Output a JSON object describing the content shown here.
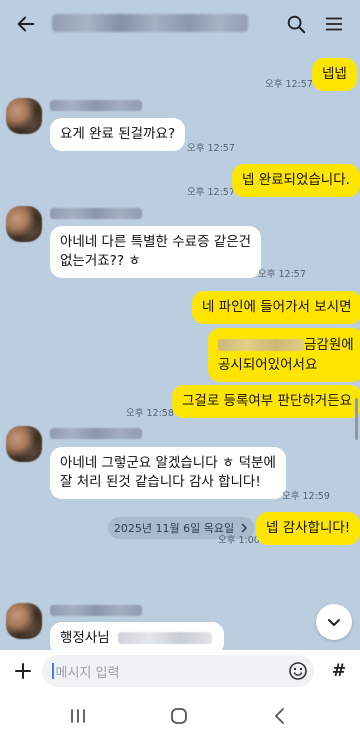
{
  "header": {
    "back_icon": "arrow-left-icon",
    "search_icon": "search-icon",
    "menu_icon": "hamburger-menu-icon"
  },
  "messages": [
    {
      "from": "me",
      "text": "넵넵",
      "time": "오후 12:57"
    },
    {
      "from": "you",
      "text": "요게 완료 된걸까요?",
      "time": "오후 12:57"
    },
    {
      "from": "me",
      "text": "넵 완료되었습니다.",
      "time": "오후 12:57"
    },
    {
      "from": "you",
      "lines": [
        "아네네 다른 특별한 수료증 같은건",
        "없는거죠?? ㅎ"
      ],
      "time": "오후 12:57"
    },
    {
      "from": "me",
      "text": "네 파인에 들어가서 보시면"
    },
    {
      "from": "me",
      "lines": [
        "금감원에",
        "공시되어있어서요"
      ]
    },
    {
      "from": "me",
      "text": "그걸로 등록여부 판단하거든요",
      "time": "오후 12:58"
    },
    {
      "from": "you",
      "lines": [
        "아네네 그렇군요 알겠습니다 ㅎ 덕분에",
        "잘 처리 된것 같습니다 감사 합니다!"
      ],
      "time": "오후 12:59"
    },
    {
      "from": "me",
      "text": "넵 감사합니다!",
      "time": "오후 1:00"
    },
    {
      "from": "you",
      "text": "행정사님"
    }
  ],
  "date_divider": "2025년 11월 6일 목요일",
  "composer": {
    "placeholder": "메시지 입력",
    "hash_label": "#"
  },
  "colors": {
    "background": "#bacee0",
    "my_bubble": "#fee500",
    "their_bubble": "#ffffff"
  }
}
